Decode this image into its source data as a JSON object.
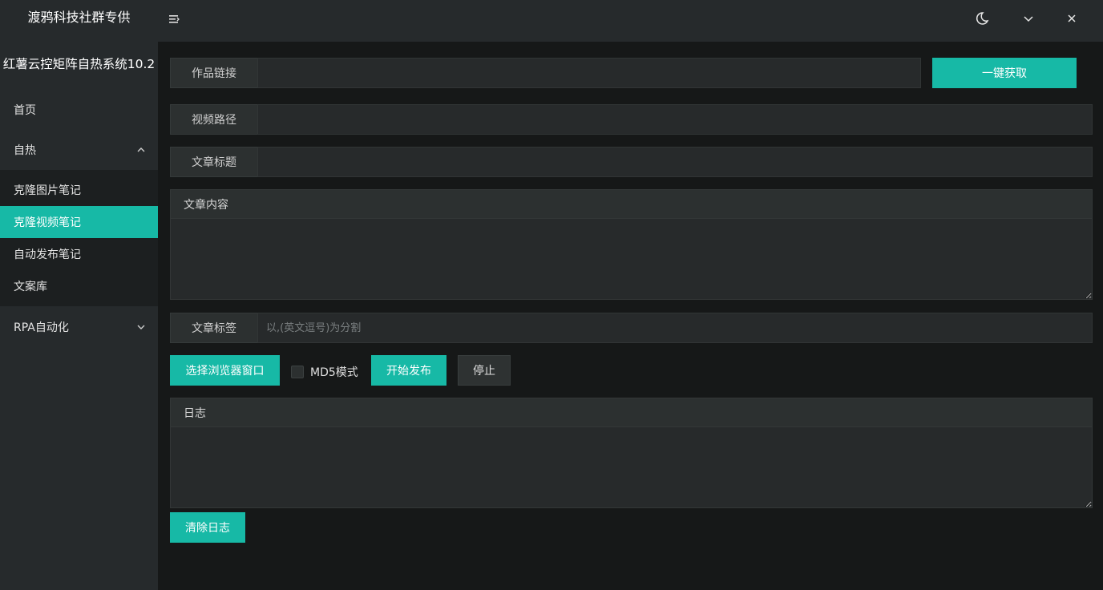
{
  "sidebar": {
    "brand": "渡鸦科技社群专供",
    "system_name": "红薯云控矩阵自热系统10.2",
    "items": [
      {
        "label": "首页"
      },
      {
        "label": "自热"
      },
      {
        "label": "RPA自动化"
      }
    ],
    "sub_items": [
      {
        "label": "克隆图片笔记"
      },
      {
        "label": "克隆视频笔记"
      },
      {
        "label": "自动发布笔记"
      },
      {
        "label": "文案库"
      }
    ]
  },
  "header": {
    "icons": [
      "menu-icon",
      "moon-icon",
      "chevron-down-icon",
      "close-icon"
    ]
  },
  "form": {
    "work_link_label": "作品链接",
    "work_link_value": "",
    "fetch_button": "一键获取",
    "video_path_label": "视频路径",
    "video_path_value": "",
    "title_label": "文章标题",
    "title_value": "",
    "content_label": "文章内容",
    "content_value": "",
    "tags_label": "文章标签",
    "tags_placeholder": "以,(英文逗号)为分割",
    "select_browser_button": "选择浏览器窗口",
    "md5_label": "MD5模式",
    "start_button": "开始发布",
    "stop_button": "停止"
  },
  "log": {
    "title": "日志",
    "value": "",
    "clear_button": "清除日志"
  },
  "colors": {
    "accent": "#17b9a6",
    "sidebar_bg": "#262a2c",
    "page_bg": "#161818"
  }
}
